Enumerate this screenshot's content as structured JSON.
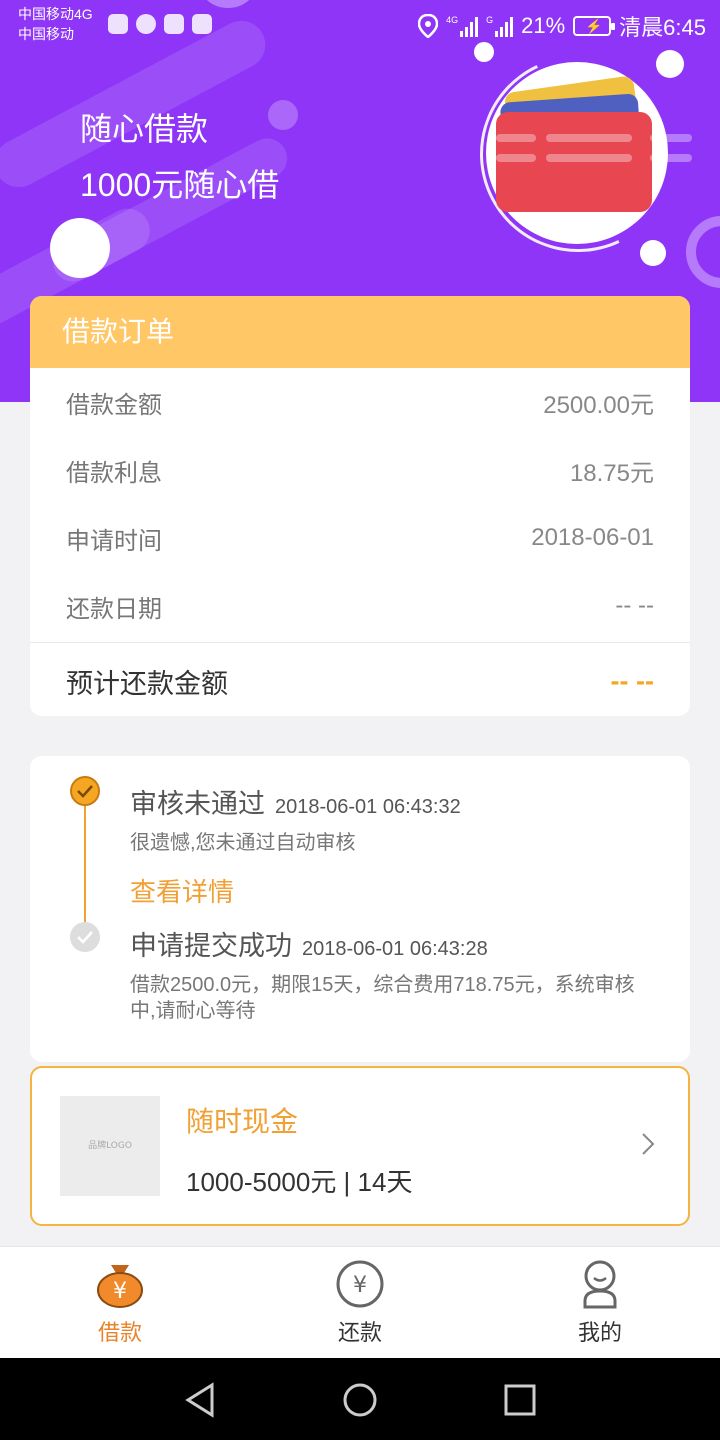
{
  "status_bar": {
    "carrier_line1": "中国移动4G",
    "carrier_line2": "中国移动",
    "battery": "21%",
    "time": "清晨6:45",
    "icons": [
      "location-icon",
      "signal-4g-icon",
      "signal-icon",
      "battery-charging-icon"
    ]
  },
  "hero": {
    "title": "随心借款",
    "subtitle": "1000元随心借",
    "illustration": "wallet-icon",
    "colors": {
      "background": "#8e35f7",
      "wallet_card_red": "#e84650",
      "wallet_card_yellow": "#f0c040",
      "wallet_card_blue": "#5060c0"
    }
  },
  "order": {
    "header": "借款订单",
    "rows": [
      {
        "label": "借款金额",
        "value": "2500.00元"
      },
      {
        "label": "借款利息",
        "value": "18.75元"
      },
      {
        "label": "申请时间",
        "value": "2018-06-01"
      },
      {
        "label": "还款日期",
        "value": "-- --"
      }
    ],
    "total_label": "预计还款金额",
    "total_value": "-- --",
    "header_color": "#ffc766"
  },
  "timeline": {
    "steps": [
      {
        "title": "审核未通过",
        "time": "2018-06-01 06:43:32",
        "desc": "很遗憾,您未通过自动审核",
        "link": "查看详情",
        "status": "active"
      },
      {
        "title": "申请提交成功",
        "time": "2018-06-01 06:43:28",
        "desc": "借款2500.0元，期限15天，综合费用718.75元，系统审核中,请耐心等待",
        "status": "done"
      }
    ],
    "accent_color": "#f0a035"
  },
  "product": {
    "name": "随时现金",
    "info": "1000-5000元 | 14天",
    "thumb_text": "品牌LOGO",
    "chevron": "chevron-right-icon"
  },
  "bottom_nav": {
    "items": [
      {
        "label": "借款",
        "icon": "money-bag-icon",
        "active": true
      },
      {
        "label": "还款",
        "icon": "yen-circle-icon",
        "active": false
      },
      {
        "label": "我的",
        "icon": "user-icon",
        "active": false
      }
    ],
    "active_color": "#e8842a"
  },
  "system_nav": [
    "back-icon",
    "home-icon",
    "recents-icon"
  ]
}
